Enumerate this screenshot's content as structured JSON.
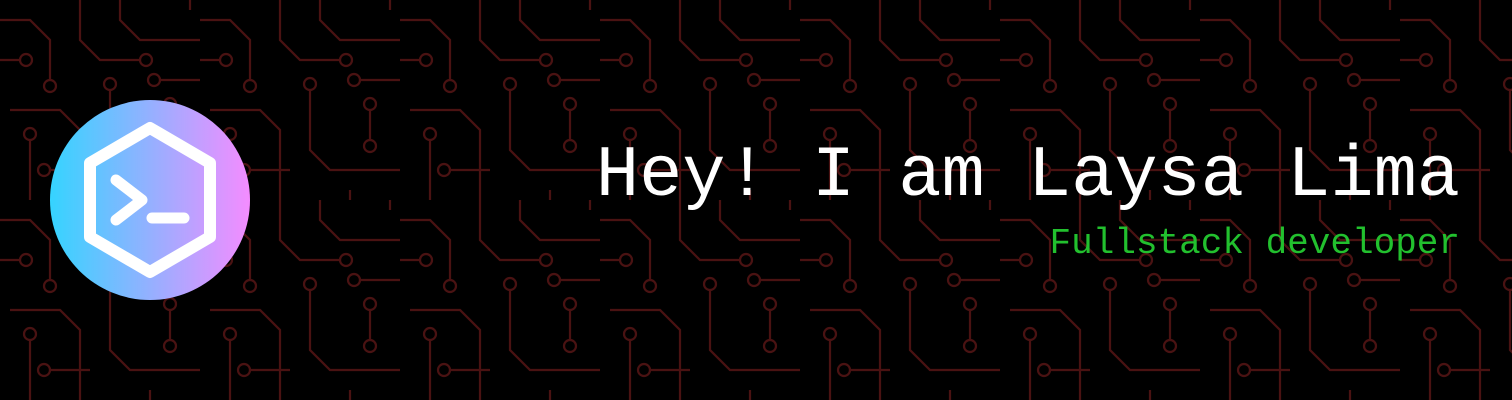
{
  "banner": {
    "title": "Hey! I am Laysa Lima",
    "subtitle": "Fullstack developer"
  },
  "logo": {
    "icon": "terminal-icon",
    "gradient_start": "#35d4ff",
    "gradient_end": "#f48cff"
  },
  "colors": {
    "background": "#000000",
    "circuit": "#4a1212",
    "title": "#ffffff",
    "subtitle": "#22c02e"
  }
}
